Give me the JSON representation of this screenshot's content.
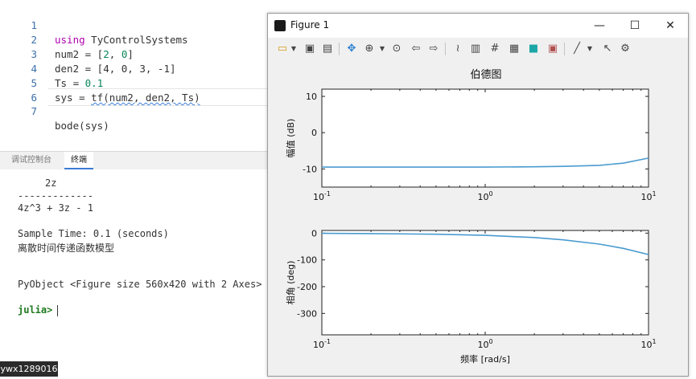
{
  "editor": {
    "lines": [
      {
        "n": "1",
        "kw": "using",
        "rest": " TyControlSystems"
      },
      {
        "n": "2",
        "a": "num2 = [",
        "v1": "2",
        "m": ", ",
        "v2": "0",
        "e": "]"
      },
      {
        "n": "3",
        "text": "den2 = [4, 0, 3, -1]"
      },
      {
        "n": "4",
        "a": "Ts = ",
        "v1": "0.1"
      },
      {
        "n": "5",
        "a": "sys = ",
        "sq": "tf(num2, den2, Ts)"
      },
      {
        "n": "6",
        "text": ""
      },
      {
        "n": "7",
        "text": "bode(sys)"
      }
    ]
  },
  "bottom_tabs": [
    "调试控制台",
    "终端"
  ],
  "terminal": {
    "numerator": "2z",
    "divider": "-------------",
    "denominator": "4z^3 + 3z - 1",
    "sample_time": "Sample Time: 0.1 (seconds)",
    "model_desc": "离散时间传递函数模型",
    "pyobject": "PyObject <Figure size 560x420 with 2 Axes>",
    "prompt": "julia>"
  },
  "watermark": "ywx1289016",
  "figure": {
    "window_title": "Figure 1",
    "controls": {
      "minimize": "—",
      "maximize": "☐",
      "close": "✕"
    },
    "toolbar_icons": [
      "open-icon",
      "save-icon",
      "save-all-icon",
      "pan-icon",
      "zoom-icon",
      "zoom-reset-icon",
      "back-icon",
      "forward-icon",
      "data-cursor-icon",
      "colorbar-icon",
      "grid-icon",
      "legend-icon",
      "color-icon",
      "property-icon",
      "line-icon",
      "pointer-icon",
      "settings-icon"
    ]
  },
  "chart_data": [
    {
      "type": "line",
      "title": "伯德图",
      "ylabel": "幅值 (dB)",
      "xlabel": "",
      "xscale": "log",
      "xlim": [
        0.1,
        10
      ],
      "ylim": [
        -15,
        12
      ],
      "yticks": [
        10,
        0,
        -10
      ],
      "xticks": [
        "10^-1",
        "10^0",
        "10^1"
      ],
      "x": [
        0.1,
        0.2,
        0.5,
        1,
        2,
        3,
        5,
        7,
        10
      ],
      "y": [
        -9.5,
        -9.5,
        -9.5,
        -9.5,
        -9.4,
        -9.3,
        -9.0,
        -8.4,
        -7.0
      ],
      "color": "#4a9bcf"
    },
    {
      "type": "line",
      "title": "",
      "ylabel": "相角 (deg)",
      "xlabel": "频率 [rad/s]",
      "xscale": "log",
      "xlim": [
        0.1,
        10
      ],
      "ylim": [
        -380,
        10
      ],
      "yticks": [
        0,
        -100,
        -200,
        -300
      ],
      "xticks": [
        "10^-1",
        "10^0",
        "10^1"
      ],
      "x": [
        0.1,
        0.2,
        0.5,
        1,
        2,
        3,
        5,
        7,
        10
      ],
      "y": [
        -0.8,
        -1.6,
        -4.1,
        -8.2,
        -16.5,
        -25,
        -41,
        -57,
        -80
      ],
      "color": "#4a9bcf"
    }
  ]
}
